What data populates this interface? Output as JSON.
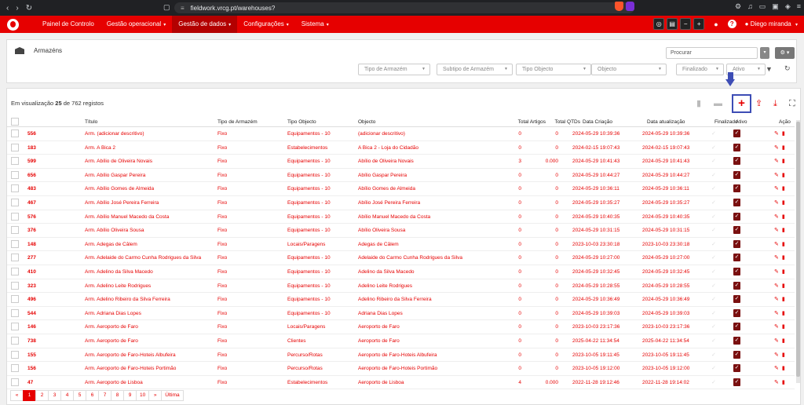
{
  "browser": {
    "url": "fieldwork.vrcg.pt/warehouses?"
  },
  "nav": {
    "menu": [
      {
        "label": "Painel de Controlo",
        "caret": false
      },
      {
        "label": "Gestão operacional",
        "caret": true
      },
      {
        "label": "Gestão de dados",
        "caret": true,
        "active": true
      },
      {
        "label": "Configurações",
        "caret": true
      },
      {
        "label": "Sistema",
        "caret": true
      }
    ],
    "user": "Diego miranda"
  },
  "filters": {
    "title": "Armazéns",
    "search_placeholder": "Procurar",
    "selects": [
      "Tipo de Armazém",
      "Subtipo de Armazém",
      "Tipo Objecto",
      "Objecto",
      "Finalizado",
      "Ativo"
    ]
  },
  "list": {
    "count_prefix": "Em visualização",
    "count_shown": "25",
    "count_mid": "de 762 registos",
    "headers": [
      "Título",
      "Tipo de Armazém",
      "Tipo Objecto",
      "Objecto",
      "Total Artigos",
      "Total QTDs",
      "Data Criação",
      "Data atualização",
      "Finalizado",
      "Ativo",
      "Ação"
    ],
    "rows": [
      [
        "556",
        "Arm. (adicionar descritivo)",
        "Fixo",
        "Equipamentos - 10",
        "(adicionar descritivo)",
        "0",
        "0",
        "2024-05-29 10:39:36",
        "2024-05-29 10:39:36"
      ],
      [
        "183",
        "Arm. A Bica 2",
        "Fixo",
        "Estabelecimentos",
        "A Bica 2 - Loja do Cidadão",
        "0",
        "0",
        "2024-02-15 19:07:43",
        "2024-02-15 19:07:43"
      ],
      [
        "599",
        "Arm. Abílio de Oliveira Novais",
        "Fixo",
        "Equipamentos - 10",
        "Abílio de Oliveira Novais",
        "3",
        "0.000",
        "2024-05-29 10:41:43",
        "2024-05-29 10:41:43"
      ],
      [
        "656",
        "Arm. Abílio Gaspar Pereira",
        "Fixo",
        "Equipamentos - 10",
        "Abílio Gaspar Pereira",
        "0",
        "0",
        "2024-05-29 10:44:27",
        "2024-05-29 10:44:27"
      ],
      [
        "483",
        "Arm. Abílio Gomes de Almeida",
        "Fixo",
        "Equipamentos - 10",
        "Abílio Gomes de Almeida",
        "0",
        "0",
        "2024-05-29 10:36:11",
        "2024-05-29 10:36:11"
      ],
      [
        "467",
        "Arm. Abílio José Pereira Ferreira",
        "Fixo",
        "Equipamentos - 10",
        "Abílio José Pereira Ferreira",
        "0",
        "0",
        "2024-05-29 10:35:27",
        "2024-05-29 10:35:27"
      ],
      [
        "576",
        "Arm. Abílio Manuel Macedo da Costa",
        "Fixo",
        "Equipamentos - 10",
        "Abílio Manuel Macedo da Costa",
        "0",
        "0",
        "2024-05-29 10:40:35",
        "2024-05-29 10:40:35"
      ],
      [
        "376",
        "Arm. Abílio Oliveira Sousa",
        "Fixo",
        "Equipamentos - 10",
        "Abílio Oliveira Sousa",
        "0",
        "0",
        "2024-05-29 10:31:15",
        "2024-05-29 10:31:15"
      ],
      [
        "148",
        "Arm. Adegas de Câlem",
        "Fixo",
        "Locais/Paragens",
        "Adegas de Câlem",
        "0",
        "0",
        "2023-10-03 23:30:18",
        "2023-10-03 23:30:18"
      ],
      [
        "277",
        "Arm. Adelaide do Carmo Cunha Rodrigues da Silva",
        "Fixo",
        "Equipamentos - 10",
        "Adelaide do Carmo Cunha Rodrigues da Silva",
        "0",
        "0",
        "2024-05-29 10:27:00",
        "2024-05-29 10:27:00"
      ],
      [
        "410",
        "Arm. Adelino da Silva Macedo",
        "Fixo",
        "Equipamentos - 10",
        "Adelino da Silva Macedo",
        "0",
        "0",
        "2024-05-29 10:32:45",
        "2024-05-29 10:32:45"
      ],
      [
        "323",
        "Arm. Adelino Leite Rodrigues",
        "Fixo",
        "Equipamentos - 10",
        "Adelino Leite Rodrigues",
        "0",
        "0",
        "2024-05-29 10:28:55",
        "2024-05-29 10:28:55"
      ],
      [
        "496",
        "Arm. Adelino Ribeiro da Silva Ferreira",
        "Fixo",
        "Equipamentos - 10",
        "Adelino Ribeiro da Silva Ferreira",
        "0",
        "0",
        "2024-05-29 10:36:49",
        "2024-05-29 10:36:49"
      ],
      [
        "544",
        "Arm. Adriana Dias Lopes",
        "Fixo",
        "Equipamentos - 10",
        "Adriana Dias Lopes",
        "0",
        "0",
        "2024-05-29 10:39:03",
        "2024-05-29 10:39:03"
      ],
      [
        "146",
        "Arm. Aeroporto de Faro",
        "Fixo",
        "Locais/Paragens",
        "Aeroporto de Faro",
        "0",
        "0",
        "2023-10-03 23:17:36",
        "2023-10-03 23:17:36"
      ],
      [
        "738",
        "Arm. Aeroporto de Faro",
        "Fixo",
        "Clientes",
        "Aeroporto de Faro",
        "0",
        "0",
        "2025-04-22 11:34:54",
        "2025-04-22 11:34:54"
      ],
      [
        "155",
        "Arm. Aeroporto de Faro-Hoteis Albufeira",
        "Fixo",
        "Percurso/Rotas",
        "Aeroporto de Faro-Hoteis Albufeira",
        "0",
        "0",
        "2023-10-05 19:11:45",
        "2023-10-05 19:11:45"
      ],
      [
        "156",
        "Arm. Aeroporto de Faro-Hoteis Portimão",
        "Fixo",
        "Percurso/Rotas",
        "Aeroporto de Faro-Hoteis Portimão",
        "0",
        "0",
        "2023-10-05 19:12:00",
        "2023-10-05 19:12:00"
      ],
      [
        "47",
        "Arm. Aeroporto de Lisboa",
        "Fixo",
        "Estabelecimentos",
        "Aeroporto de Lisboa",
        "4",
        "0.000",
        "2022-11-28 19:12:46",
        "2022-11-28 19:14:02"
      ]
    ]
  },
  "pager": {
    "first": "«",
    "pages": [
      "1",
      "2",
      "3",
      "4",
      "5",
      "6",
      "7",
      "8",
      "9",
      "10"
    ],
    "next": "»",
    "last": "Última"
  },
  "colors": {
    "brand": "#e60000",
    "active_bg": "#b30000",
    "annotation": "#3d4db5"
  }
}
